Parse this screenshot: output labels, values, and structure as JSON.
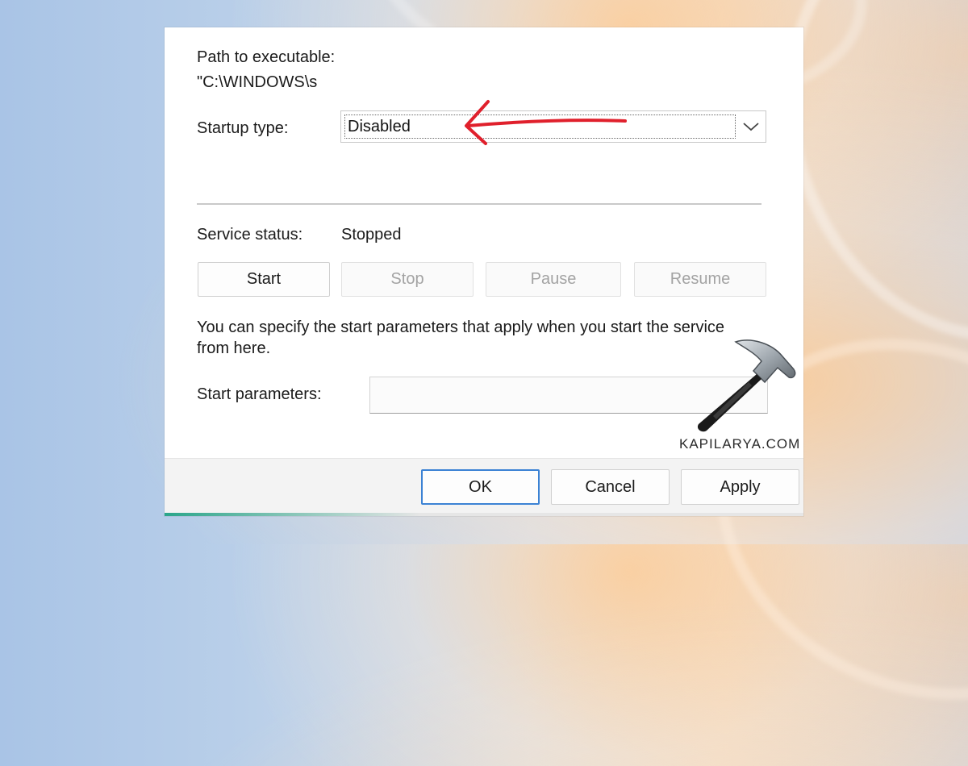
{
  "dialog": {
    "path_label": "Path to executable:",
    "path_value": "\"C:\\WINDOWS\\s",
    "startup_type_label": "Startup type:",
    "startup_type_value": "Disabled",
    "service_status_label": "Service status:",
    "service_status_value": "Stopped",
    "buttons": {
      "start": "Start",
      "stop": "Stop",
      "pause": "Pause",
      "resume": "Resume"
    },
    "help_text_line1": "You can specify the start parameters that apply when you start the service",
    "help_text_line2": "from here.",
    "start_parameters_label": "Start parameters:",
    "start_parameters_value": "",
    "footer": {
      "ok": "OK",
      "cancel": "Cancel",
      "apply": "Apply"
    }
  },
  "watermark": {
    "brand": "KAPILARYA.COM",
    "icon": "hammer-icon"
  },
  "annotation": {
    "icon": "red-arrow-icon",
    "color": "#e0202c"
  },
  "colors": {
    "default_button_border": "#3b82d4",
    "disabled_text": "#a3a3a3"
  }
}
